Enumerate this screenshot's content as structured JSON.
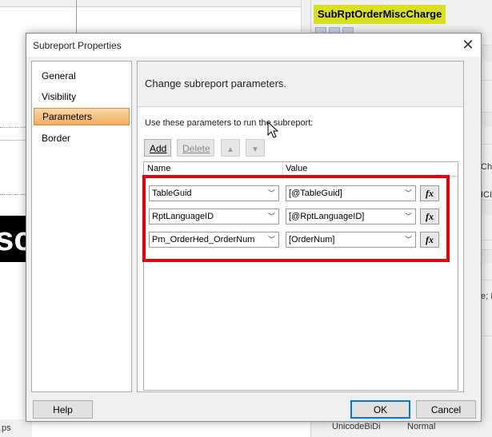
{
  "background": {
    "left_partial_text": "scc",
    "bottom_left_text": "ps",
    "properties_panel": {
      "title": "SubRptOrderMiscCharge",
      "cut_off_labels": [
        "Cha",
        "ICI",
        "e; D"
      ],
      "bottom_row": {
        "name": "UnicodeBiDi",
        "value": "Normal"
      }
    }
  },
  "dialog": {
    "title": "Subreport Properties",
    "nav_items": [
      "General",
      "Visibility",
      "Parameters",
      "Border"
    ],
    "selected_nav": "Parameters",
    "header": "Change subreport parameters.",
    "instructions": "Use these parameters to run the subreport:",
    "buttons": {
      "add": "Add",
      "delete": "Delete",
      "move_up_icon": "arrow-up-icon",
      "move_down_icon": "arrow-down-icon"
    },
    "columns": [
      "Name",
      "Value"
    ],
    "parameters": [
      {
        "name": "TableGuid",
        "value": "[@TableGuid]"
      },
      {
        "name": "RptLanguageID",
        "value": "[@RptLanguageID]"
      },
      {
        "name": "Pm_OrderHed_OrderNum",
        "value": "[OrderNum]"
      }
    ],
    "expression_button_label": "fx",
    "highlight_color": "#e8000b",
    "footer": {
      "help": "Help",
      "ok": "OK",
      "cancel": "Cancel"
    }
  }
}
